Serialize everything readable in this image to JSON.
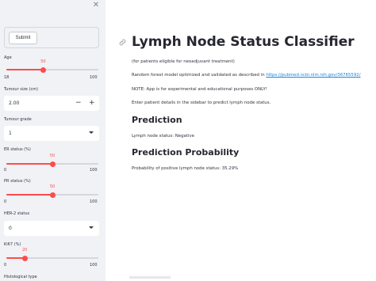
{
  "sidebar": {
    "close_icon": "✕",
    "submit_label": "Submit",
    "age": {
      "label": "Age",
      "value": "50",
      "min": "18",
      "max": "100",
      "fraction": 0.4
    },
    "tumour_size": {
      "label": "Tumour size (cm)",
      "value": "2.00"
    },
    "tumour_grade": {
      "label": "Tumour grade",
      "value": "1"
    },
    "er_status": {
      "label": "ER status (%)",
      "value": "50",
      "min": "0",
      "max": "100",
      "fraction": 0.5
    },
    "pr_status": {
      "label": "PR status (%)",
      "value": "50",
      "min": "0",
      "max": "100",
      "fraction": 0.5
    },
    "her2_status": {
      "label": "HER-2 status",
      "value": "0"
    },
    "ki67": {
      "label": "Ki67 (%)",
      "value": "20",
      "min": "0",
      "max": "100",
      "fraction": 0.2
    },
    "histological_type": {
      "label": "Histological type"
    }
  },
  "main": {
    "title": "Lymph Node Status Classifier",
    "subtitle": "(for patients eligible for neoadjuvant treatment)",
    "description_prefix": "Random forest model optimized and validated as described in ",
    "description_link": "https://pubmed.ncbi.nlm.nih.gov/36765592/",
    "note": "NOTE: App is for experimental and educational purposes ONLY!",
    "instruction": "Enter patient details in the sidebar to predict lymph node status.",
    "prediction_heading": "Prediction",
    "prediction_text": "Lymph node status: Negative",
    "probability_heading": "Prediction Probability",
    "probability_text": "Probability of positive lymph node status: 35.29%"
  },
  "colors": {
    "accent": "#ff4b4b",
    "link": "#1c83e1",
    "sidebar_bg": "#f0f2f6"
  },
  "icons": {
    "close": "close-icon",
    "link": "link-icon",
    "minus": "minus-icon",
    "plus": "plus-icon",
    "chevron": "chevron-down-icon"
  }
}
